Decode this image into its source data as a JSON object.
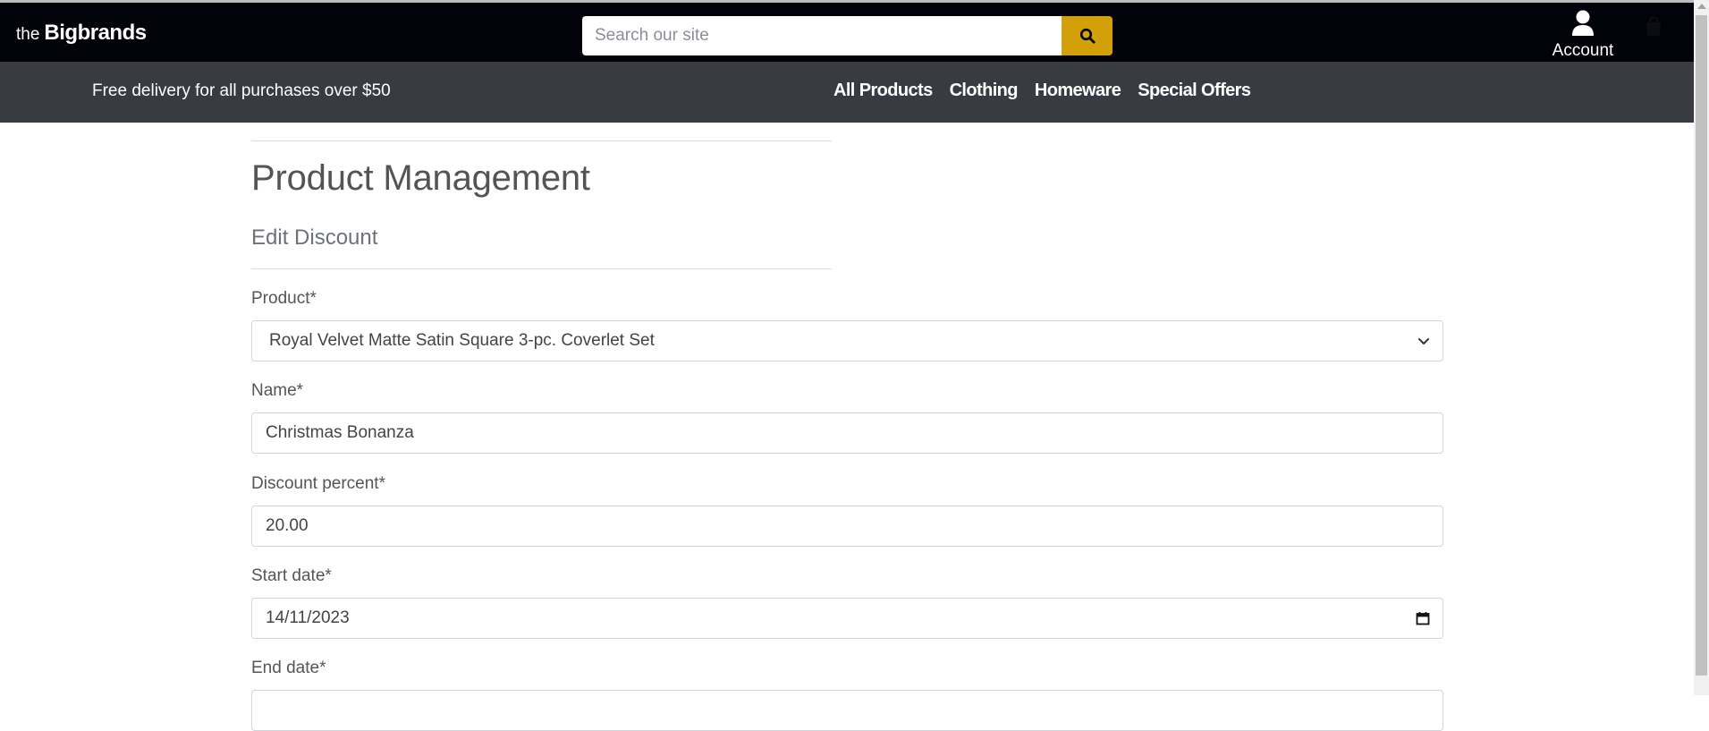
{
  "header": {
    "logo_prefix": "the",
    "logo_brand": "Bigbrands",
    "search": {
      "placeholder": "Search our site"
    },
    "account_label": "Account"
  },
  "nav": {
    "promo_text": "Free delivery for all purchases over $50",
    "links": [
      {
        "label": "All Products"
      },
      {
        "label": "Clothing"
      },
      {
        "label": "Homeware"
      },
      {
        "label": "Special Offers"
      }
    ]
  },
  "main": {
    "title": "Product Management",
    "subtitle": "Edit Discount",
    "fields": {
      "product": {
        "label": "Product*",
        "value": "Royal Velvet Matte Satin Square 3-pc. Coverlet Set"
      },
      "name": {
        "label": "Name*",
        "value": "Christmas Bonanza"
      },
      "discount_percent": {
        "label": "Discount percent*",
        "value": "20.00"
      },
      "start_date": {
        "label": "Start date*",
        "value": "14/11/2023"
      },
      "end_date": {
        "label": "End date*",
        "value": ""
      }
    }
  },
  "colors": {
    "header_bg": "#02030a",
    "nav_bg": "#383c42",
    "accent": "#d4a00a"
  }
}
